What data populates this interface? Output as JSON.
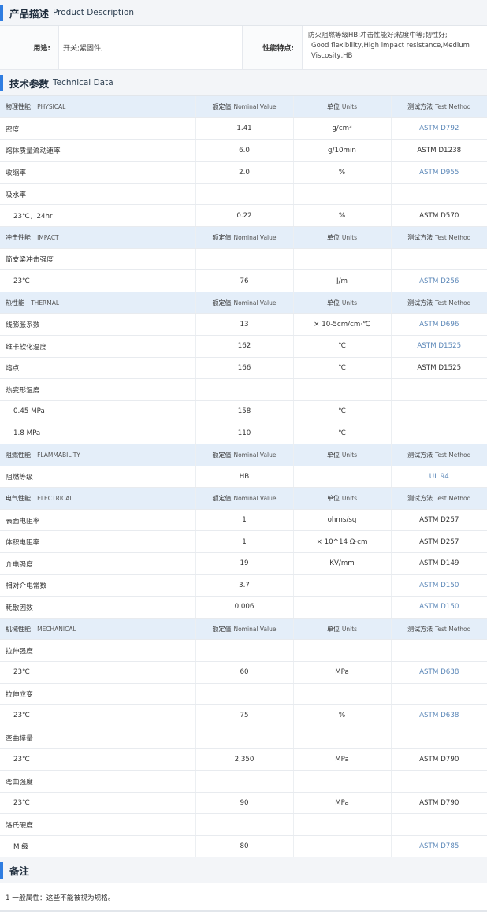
{
  "product_description": {
    "title_zh": "产品描述",
    "title_en": "Product Description",
    "use_label": "用途:",
    "use_value": "开关;紧固件;",
    "feature_label": "性能特点:",
    "feature_value_zh": "防火阻燃等级HB;冲击性能好;粘度中等;韧性好;",
    "feature_value_en": "Good flexibility,High impact resistance,Medium Viscosity,HB"
  },
  "technical_data": {
    "title_zh": "技术参数",
    "title_en": "Technical Data",
    "header": {
      "nominal_zh": "额定值",
      "nominal_en": "Nominal Value",
      "unit_zh": "单位",
      "unit_en": "Units",
      "method_zh": "测试方法",
      "method_en": "Test Method"
    },
    "sections": [
      {
        "name_zh": "物理性能",
        "name_en": "PHYSICAL",
        "rows": [
          {
            "name": "密度",
            "value": "1.41",
            "unit": "g/cm³",
            "method": "ASTM D792",
            "link": true
          },
          {
            "name": "熔体质量流动速率",
            "value": "6.0",
            "unit": "g/10min",
            "method": "ASTM D1238",
            "link": false
          },
          {
            "name": "收缩率",
            "value": "2.0",
            "unit": "%",
            "method": "ASTM D955",
            "link": true
          },
          {
            "name": "吸水率",
            "value": "",
            "unit": "",
            "method": "",
            "link": false
          },
          {
            "name": "23℃，24hr",
            "value": "0.22",
            "unit": "%",
            "method": "ASTM D570",
            "link": false,
            "sub": true
          }
        ]
      },
      {
        "name_zh": "冲击性能",
        "name_en": "IMPACT",
        "rows": [
          {
            "name": "简支梁冲击强度",
            "value": "",
            "unit": "",
            "method": "",
            "link": false
          },
          {
            "name": "23℃",
            "value": "76",
            "unit": "J/m",
            "method": "ASTM D256",
            "link": true,
            "sub": true
          }
        ]
      },
      {
        "name_zh": "热性能",
        "name_en": "THERMAL",
        "rows": [
          {
            "name": "线膨胀系数",
            "value": "13",
            "unit": "× 10-5cm/cm·℃",
            "method": "ASTM D696",
            "link": true
          },
          {
            "name": "维卡软化温度",
            "value": "162",
            "unit": "℃",
            "method": "ASTM D1525",
            "link": true
          },
          {
            "name": "熔点",
            "value": "166",
            "unit": "℃",
            "method": "ASTM D1525",
            "link": false
          },
          {
            "name": "热变形温度",
            "value": "",
            "unit": "",
            "method": "",
            "link": false
          },
          {
            "name": "0.45 MPa",
            "value": "158",
            "unit": "℃",
            "method": "",
            "link": false,
            "sub": true
          },
          {
            "name": "1.8 MPa",
            "value": "110",
            "unit": "℃",
            "method": "",
            "link": false,
            "sub": true
          }
        ]
      },
      {
        "name_zh": "阻燃性能",
        "name_en": "FLAMMABILITY",
        "rows": [
          {
            "name": "阻燃等级",
            "value": "HB",
            "unit": "",
            "method": "UL 94",
            "link": true
          }
        ]
      },
      {
        "name_zh": "电气性能",
        "name_en": "ELECTRICAL",
        "rows": [
          {
            "name": "表面电阻率",
            "value": "1",
            "unit": "ohms/sq",
            "method": "ASTM D257",
            "link": false
          },
          {
            "name": "体积电阻率",
            "value": "1",
            "unit": "× 10^14 Ω·cm",
            "method": "ASTM D257",
            "link": false
          },
          {
            "name": "介电强度",
            "value": "19",
            "unit": "KV/mm",
            "method": "ASTM D149",
            "link": false
          },
          {
            "name": "相对介电常数",
            "value": "3.7",
            "unit": "",
            "method": "ASTM D150",
            "link": true
          },
          {
            "name": "耗散因数",
            "value": "0.006",
            "unit": "",
            "method": "ASTM D150",
            "link": true
          }
        ]
      },
      {
        "name_zh": "机械性能",
        "name_en": "MECHANICAL",
        "rows": [
          {
            "name": "拉伸强度",
            "value": "",
            "unit": "",
            "method": "",
            "link": false
          },
          {
            "name": "23℃",
            "value": "60",
            "unit": "MPa",
            "method": "ASTM D638",
            "link": true,
            "sub": true
          },
          {
            "name": "拉伸应变",
            "value": "",
            "unit": "",
            "method": "",
            "link": false
          },
          {
            "name": "23℃",
            "value": "75",
            "unit": "%",
            "method": "ASTM D638",
            "link": true,
            "sub": true
          },
          {
            "name": "弯曲模量",
            "value": "",
            "unit": "",
            "method": "",
            "link": false
          },
          {
            "name": "23℃",
            "value": "2,350",
            "unit": "MPa",
            "method": "ASTM D790",
            "link": false,
            "sub": true
          },
          {
            "name": "弯曲强度",
            "value": "",
            "unit": "",
            "method": "",
            "link": false
          },
          {
            "name": "23℃",
            "value": "90",
            "unit": "MPa",
            "method": "ASTM D790",
            "link": false,
            "sub": true
          },
          {
            "name": "洛氏硬度",
            "value": "",
            "unit": "",
            "method": "",
            "link": false
          },
          {
            "name": "M 级",
            "value": "80",
            "unit": "",
            "method": "ASTM D785",
            "link": true,
            "sub": true
          }
        ]
      }
    ]
  },
  "notes": {
    "title_zh": "备注",
    "text": "1 一般属性：这些不能被视为规格。"
  },
  "colors": {
    "accent": "#2f7de1",
    "category_bg": "#e4eef9",
    "link": "#5b87b8"
  }
}
